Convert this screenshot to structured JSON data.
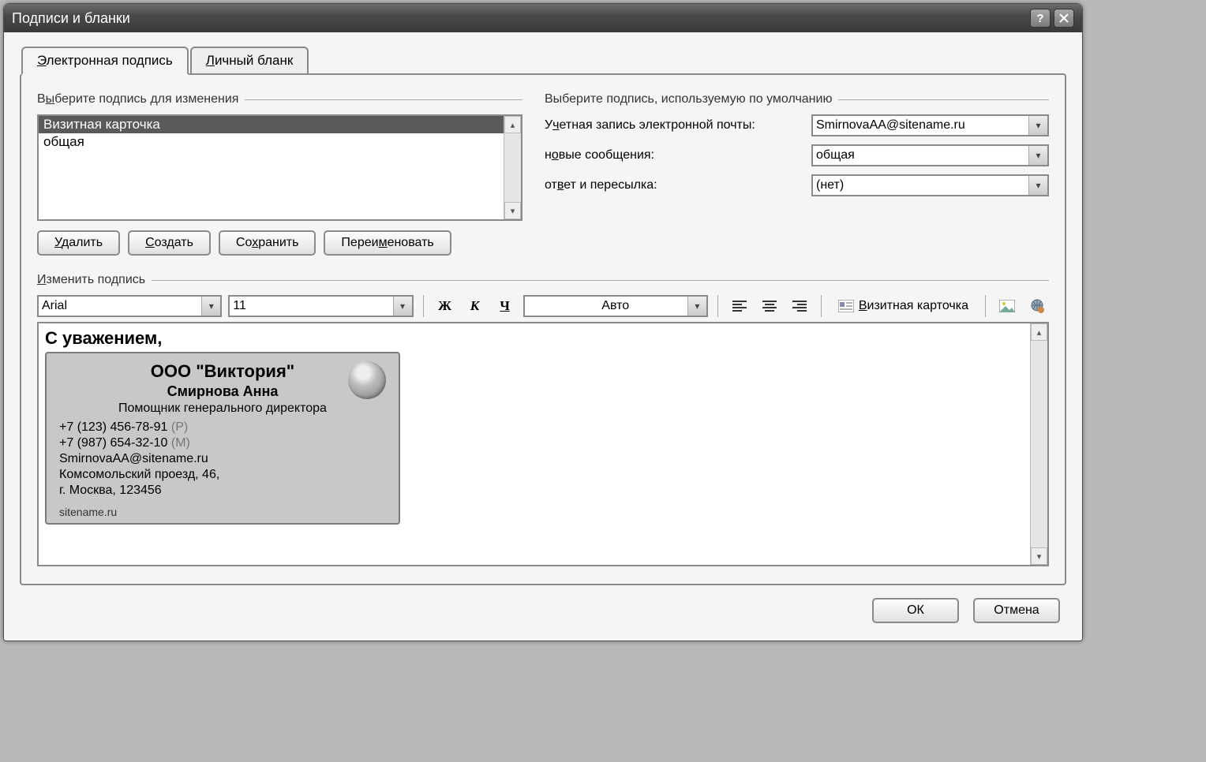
{
  "window": {
    "title": "Подписи и бланки"
  },
  "tabs": {
    "signature": {
      "label": "Электронная подпись",
      "mnemonic": "Э"
    },
    "stationery": {
      "label": "Личный бланк",
      "mnemonic": "Л"
    }
  },
  "select_group": {
    "legend": "Выберите подпись для изменения",
    "legend_mnemonic": "ы",
    "items": [
      "Визитная карточка",
      "общая"
    ],
    "selected_index": 0,
    "buttons": {
      "delete": "Удалить",
      "new": "Создать",
      "save": "Сохранить",
      "rename": "Переименовать"
    }
  },
  "defaults": {
    "legend": "Выберите подпись, используемую по умолчанию",
    "account_label": "Учетная запись электронной почты:",
    "account_value": "SmirnovaAA@sitename.ru",
    "new_label": "новые сообщения:",
    "new_value": "общая",
    "reply_label": "ответ и пересылка:",
    "reply_value": "(нет)"
  },
  "edit": {
    "legend": "Изменить подпись",
    "font": "Arial",
    "size": "11",
    "color": "Авто",
    "vcard_button": "Визитная карточка"
  },
  "signature_body": {
    "greeting": "С уважением,",
    "card": {
      "company": "ООО \"Виктория\"",
      "name": "Смирнова Анна",
      "title": "Помощник генерального директора",
      "phone_work": "+7 (123) 456-78-91",
      "phone_work_tag": "(Р)",
      "phone_mobile": "+7 (987) 654-32-10",
      "phone_mobile_tag": "(М)",
      "email": "SmirnovaAA@sitename.ru",
      "address1": "Комсомольский проезд, 46,",
      "address2": "г. Москва, 123456",
      "website": "sitename.ru"
    }
  },
  "footer": {
    "ok": "ОК",
    "cancel": "Отмена"
  }
}
